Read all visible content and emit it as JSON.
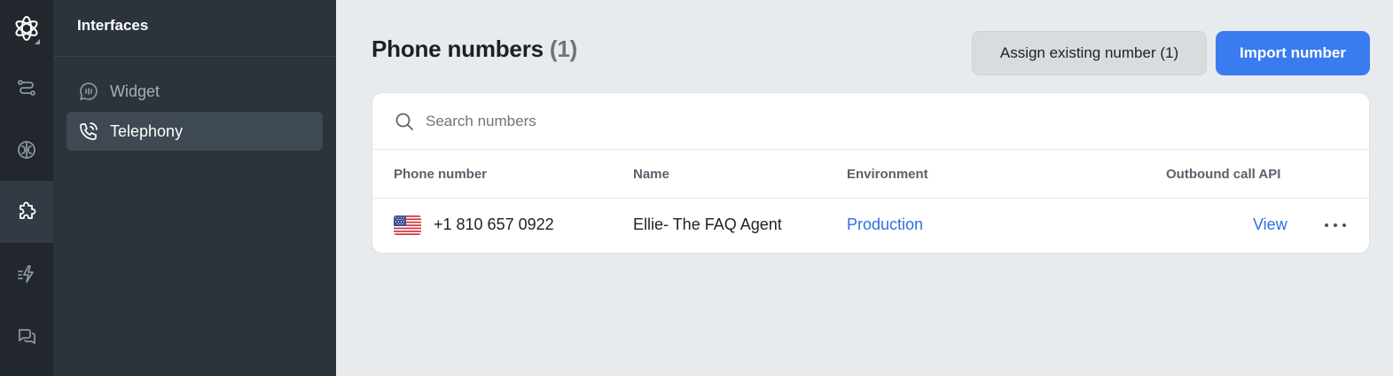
{
  "sidebar": {
    "section_title": "Interfaces",
    "items": [
      {
        "label": "Widget",
        "icon": "chat-bubble-icon",
        "active": false
      },
      {
        "label": "Telephony",
        "icon": "phone-call-icon",
        "active": true
      }
    ]
  },
  "rail": {
    "items": [
      {
        "icon": "flow-icon",
        "active": false
      },
      {
        "icon": "brain-icon",
        "active": false
      },
      {
        "icon": "puzzle-icon",
        "active": true
      },
      {
        "icon": "lightning-icon",
        "active": false
      },
      {
        "icon": "conversations-icon",
        "active": false
      }
    ]
  },
  "page": {
    "title": "Phone numbers",
    "count": "(1)"
  },
  "actions": {
    "assign_label": "Assign existing number (1)",
    "import_label": "Import number"
  },
  "search": {
    "placeholder": "Search numbers"
  },
  "table": {
    "columns": [
      "Phone number",
      "Name",
      "Environment",
      "Outbound call API"
    ],
    "rows": [
      {
        "flag": "us-flag-icon",
        "phone": "+1 810 657 0922",
        "name": "Ellie- The FAQ Agent",
        "environment": "Production",
        "outbound": "View"
      }
    ]
  },
  "colors": {
    "accent": "#3a7bf0",
    "link": "#2f6fe0",
    "rail_bg": "#21272d",
    "sidebar_bg": "#2b333b",
    "main_bg": "#e8ebed"
  }
}
